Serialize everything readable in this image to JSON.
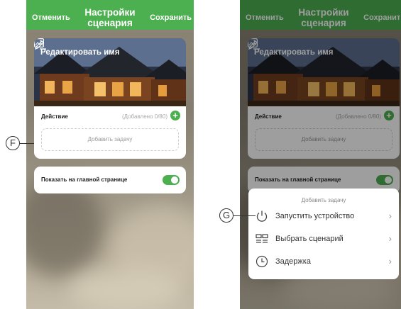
{
  "header": {
    "cancel_label": "Отменить",
    "title_line1": "Настройки",
    "title_line2": "сценария",
    "save_label": "Сохранить"
  },
  "scene": {
    "name": "Редактировать имя"
  },
  "action": {
    "label": "Действие",
    "count": "(Добавлено 0/80)",
    "add_task": "Добавить задачу"
  },
  "home": {
    "label": "Показать на главной странице",
    "enabled": true
  },
  "sheet": {
    "title": "Добавить задачу",
    "items": [
      {
        "label": "Запустить устройство",
        "icon": "power-icon"
      },
      {
        "label": "Выбрать сценарий",
        "icon": "grid-icon"
      },
      {
        "label": "Задержка",
        "icon": "clock-icon"
      }
    ]
  },
  "callouts": {
    "left": "F",
    "right": "G"
  },
  "colors": {
    "accent": "#4caf50"
  }
}
